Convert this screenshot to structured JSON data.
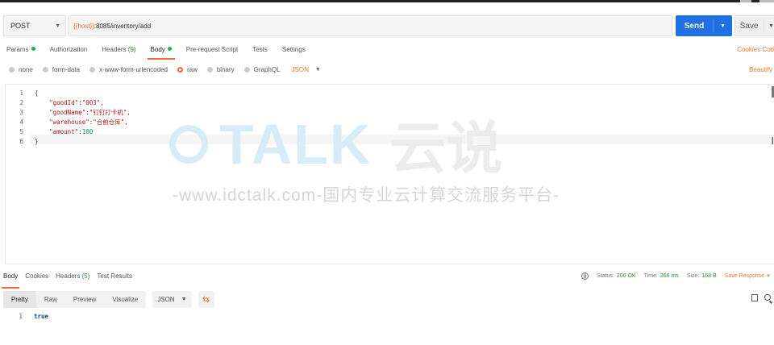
{
  "request": {
    "method": "POST",
    "url_var": "{{host}}",
    "url_rest": ":8085/inventory/add",
    "send_label": "Send",
    "save_label": "Save"
  },
  "req_tabs": [
    {
      "label": "Params",
      "dot": true
    },
    {
      "label": "Authorization"
    },
    {
      "label": "Headers",
      "count": "(9)"
    },
    {
      "label": "Body",
      "dot": true,
      "active": true
    },
    {
      "label": "Pre-request Script"
    },
    {
      "label": "Tests"
    },
    {
      "label": "Settings"
    }
  ],
  "cookies_label": "Cookies Cod",
  "body_types": [
    "none",
    "form-data",
    "x-www-form-urlencoded",
    "raw",
    "binary",
    "GraphQL"
  ],
  "body_format": "JSON",
  "beautify_label": "Beautify",
  "editor_lines": [
    {
      "n": "1",
      "text": "{"
    },
    {
      "n": "2",
      "key": "\"goodId\"",
      "val": "\"003\","
    },
    {
      "n": "3",
      "key": "\"goodName\"",
      "val": "\"钉钉打卡机\","
    },
    {
      "n": "4",
      "key": "\"warehouse\"",
      "val": "\"合前仓库\","
    },
    {
      "n": "5",
      "key": "\"amount\"",
      "num": "100"
    },
    {
      "n": "6",
      "text": "}"
    }
  ],
  "watermark": {
    "logo_text": "TALK",
    "logo_cn": "云说",
    "tagline": "-www.idctalk.com-国内专业云计算交流服务平台-"
  },
  "resp_tabs": [
    {
      "label": "Body",
      "active": true
    },
    {
      "label": "Cookies"
    },
    {
      "label": "Headers",
      "count": "(5)"
    },
    {
      "label": "Test Results"
    }
  ],
  "resp_status": {
    "status_label": "Status:",
    "status_value": "200 OK",
    "time_label": "Time:",
    "time_value": "266 ms",
    "size_label": "Size:",
    "size_value": "168 B",
    "save_response": "Save Response"
  },
  "resp_views": [
    "Pretty",
    "Raw",
    "Preview",
    "Visualize"
  ],
  "resp_format": "JSON",
  "resp_body": {
    "n": "1",
    "text": "true"
  },
  "colors": {
    "accent": "#f26b3a",
    "send": "#1f70e0",
    "ok": "#2a8a2a"
  }
}
